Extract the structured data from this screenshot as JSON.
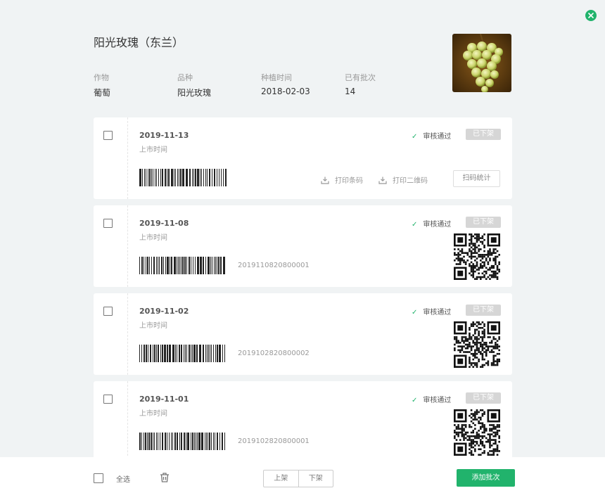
{
  "header": {
    "title": "阳光玫瑰（东兰）",
    "close_icon": "close-circle-icon",
    "meta": [
      {
        "label": "作物",
        "value": "葡萄"
      },
      {
        "label": "品种",
        "value": "阳光玫瑰"
      },
      {
        "label": "种植时间",
        "value": "2018-02-03"
      },
      {
        "label": "已有批次",
        "value": "14"
      }
    ],
    "photo_alt": "grape-cluster-photo"
  },
  "batches": [
    {
      "date": "2019-11-13",
      "date_label": "上市时间",
      "status": "审核通过",
      "badge": "已下架",
      "print_barcode": "打印条码",
      "print_qrcode": "打印二维码",
      "scan_stats": "扫码统计"
    },
    {
      "date": "2019-11-08",
      "date_label": "上市时间",
      "barcode_number": "2019110820800001",
      "status": "审核通过",
      "badge": "已下架"
    },
    {
      "date": "2019-11-02",
      "date_label": "上市时间",
      "barcode_number": "2019102820800002",
      "status": "审核通过",
      "badge": "已下架"
    },
    {
      "date": "2019-11-01",
      "date_label": "上市时间",
      "barcode_number": "2019102820800001",
      "status": "审核通过",
      "badge": "已下架"
    }
  ],
  "footer": {
    "select_all": "全选",
    "trash_icon": "trash-icon",
    "list_on": "上架",
    "list_off": "下架",
    "add_batch": "添加批次"
  },
  "colors": {
    "accent": "#21b36c",
    "background": "#f0f3f4",
    "badge": "#d6d6d6"
  }
}
